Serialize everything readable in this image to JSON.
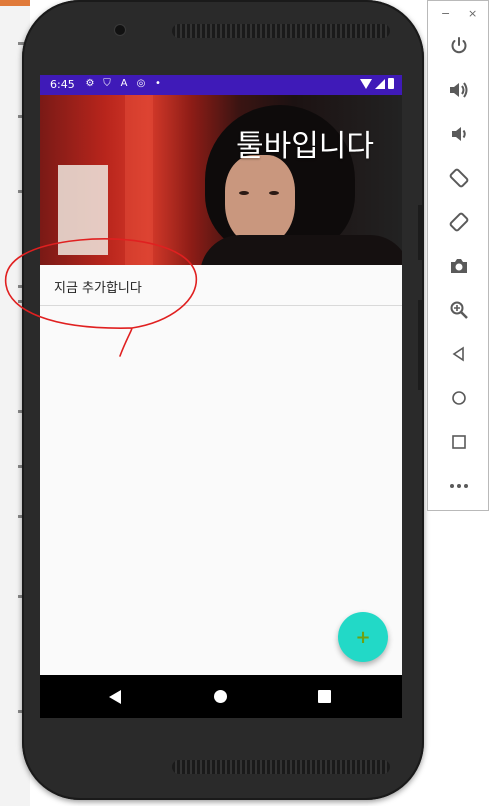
{
  "status_bar": {
    "time": "6:45"
  },
  "toolbar": {
    "title": "툴바입니다"
  },
  "list": {
    "items": [
      {
        "label": "지금 추가합니다"
      }
    ]
  },
  "fab": {
    "icon": "plus-icon",
    "symbol": "+"
  },
  "navigation": {
    "back": "back-icon",
    "home": "home-icon",
    "recents": "recents-icon"
  },
  "emulator_panel": {
    "window_controls": {
      "minimize": "−",
      "close": "×"
    },
    "buttons": [
      {
        "name": "power-icon",
        "glyph": "⏻"
      },
      {
        "name": "volume-up-icon",
        "glyph": "🔊"
      },
      {
        "name": "volume-down-icon",
        "glyph": "🔉"
      },
      {
        "name": "rotate-left-icon",
        "glyph": "⟲"
      },
      {
        "name": "rotate-right-icon",
        "glyph": "⟳"
      },
      {
        "name": "camera-icon",
        "glyph": "📷"
      },
      {
        "name": "zoom-icon",
        "glyph": "⊕"
      },
      {
        "name": "back-icon",
        "glyph": "◁"
      },
      {
        "name": "home-icon",
        "glyph": "○"
      },
      {
        "name": "overview-icon",
        "glyph": "□"
      },
      {
        "name": "more-icon",
        "glyph": "•••"
      }
    ]
  },
  "colors": {
    "status_bar": "#3f1ab8",
    "fab": "#22d9c7",
    "fab_plus": "#6fa112",
    "annotation": "#e02020"
  }
}
